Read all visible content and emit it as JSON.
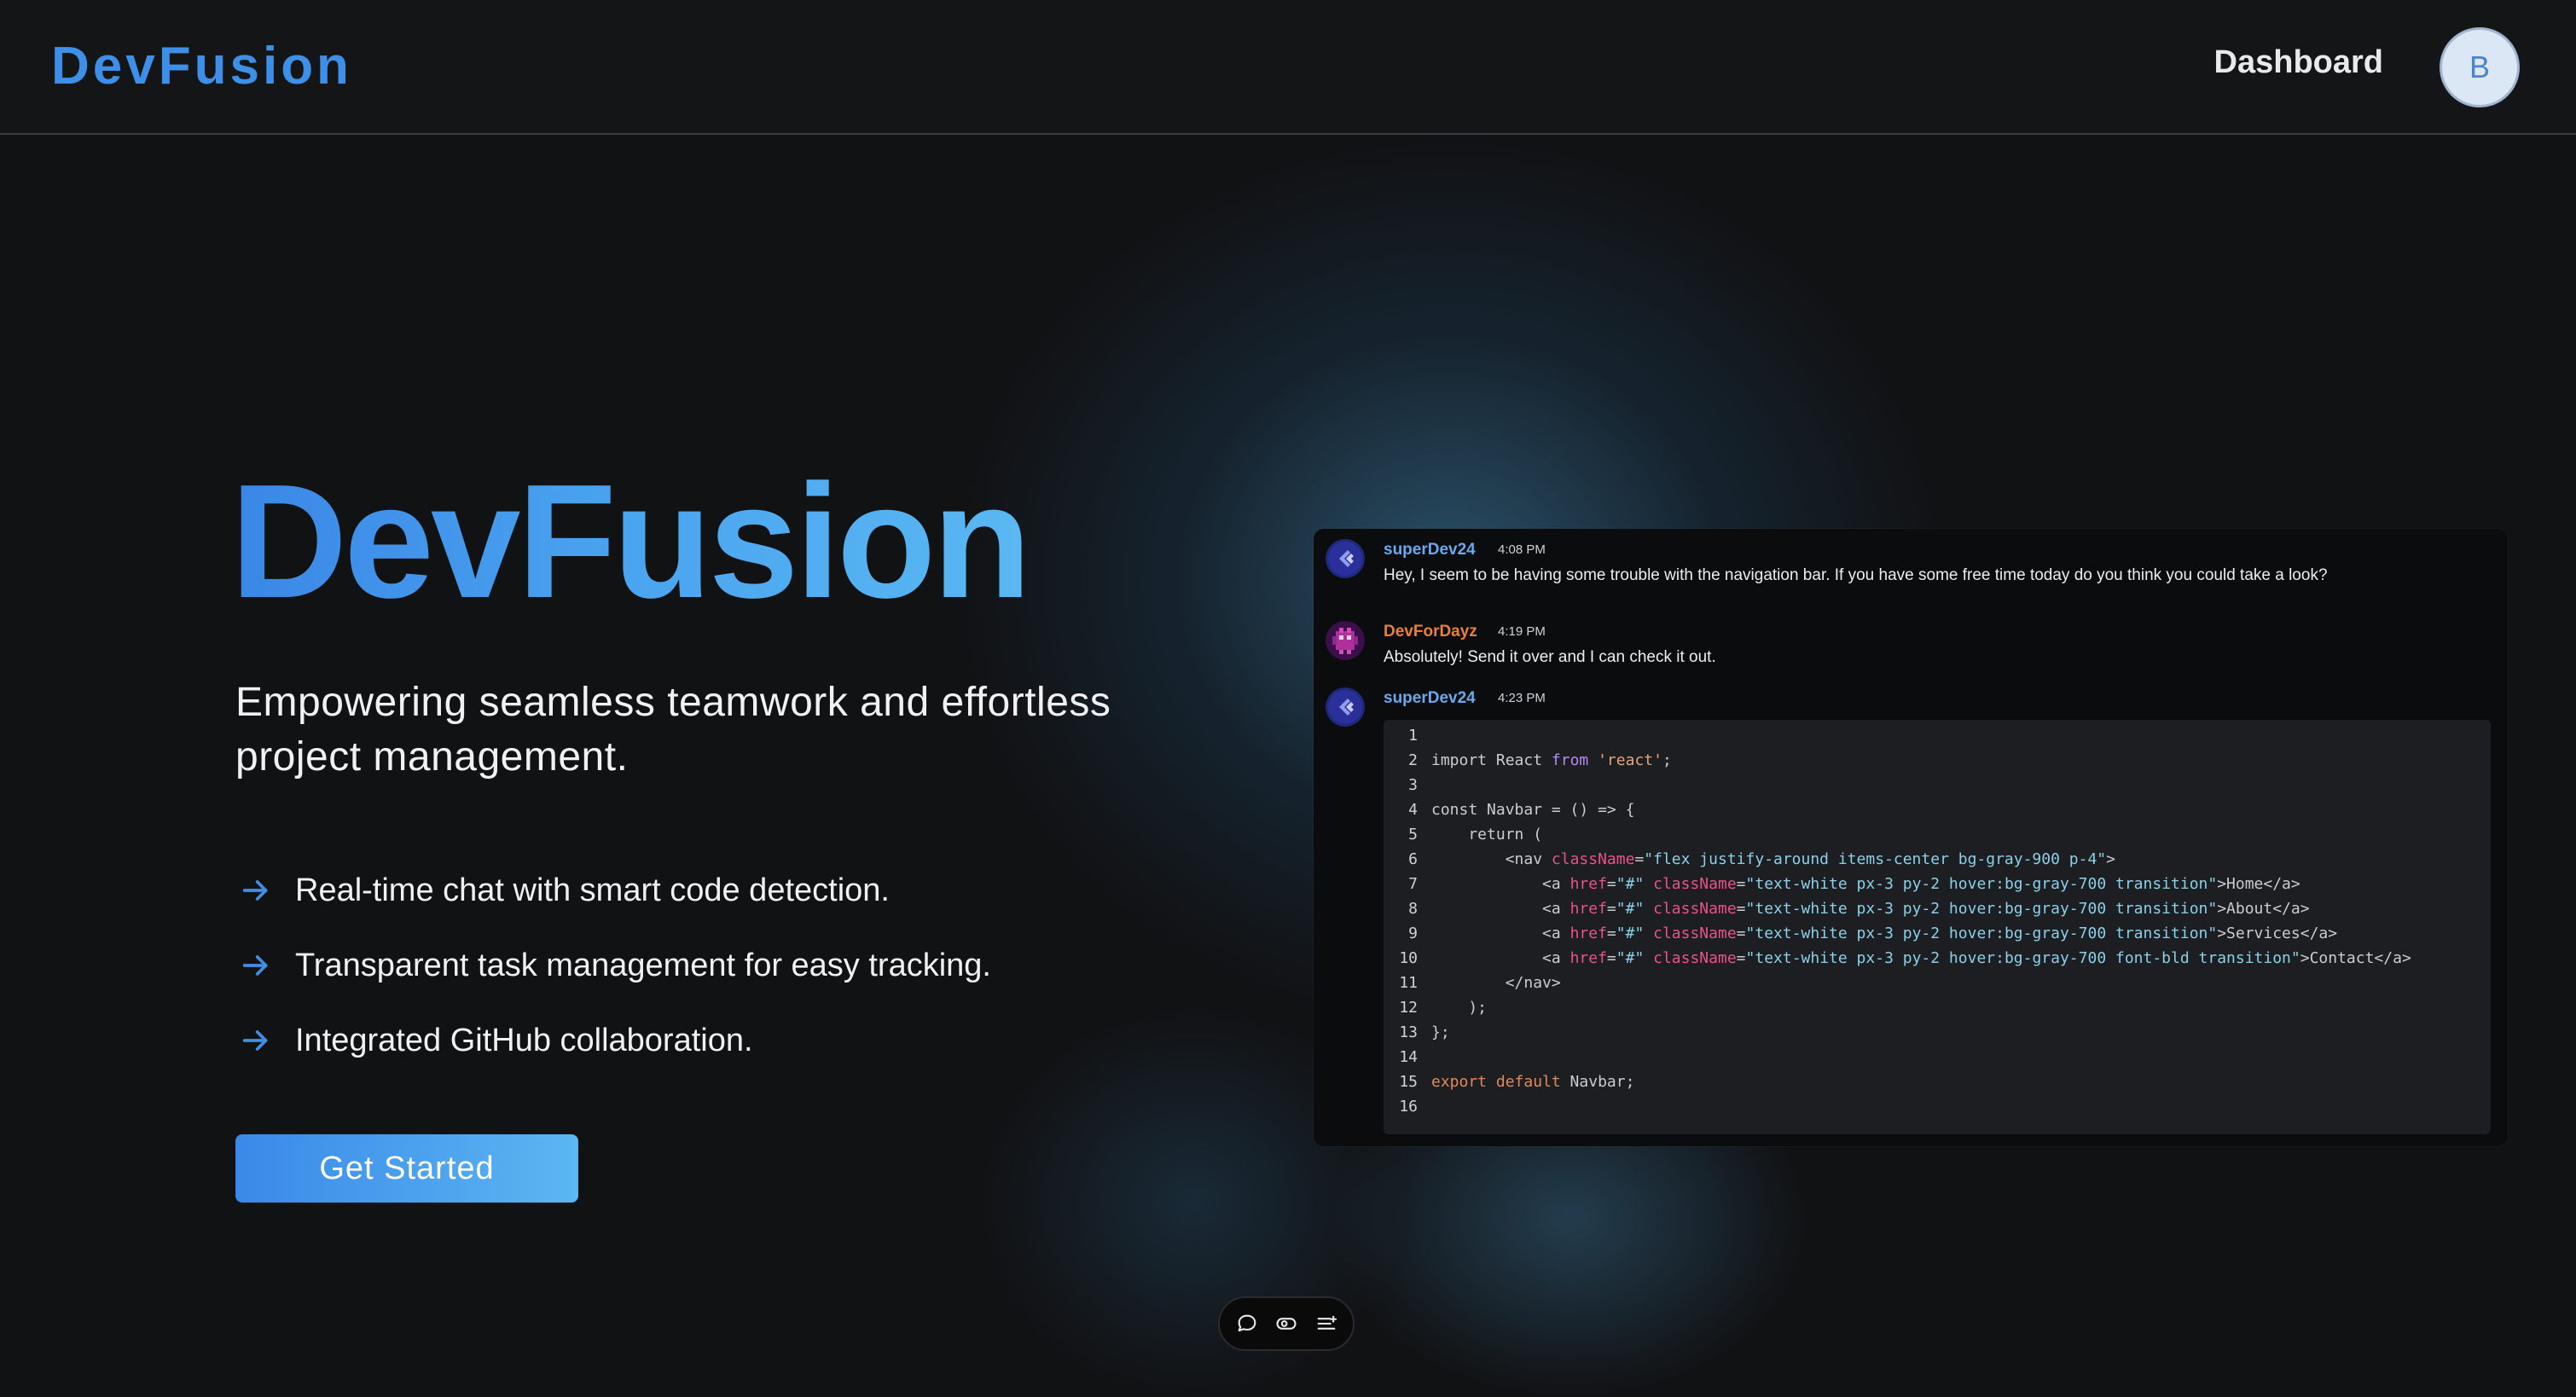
{
  "header": {
    "brand": "DevFusion",
    "nav_dashboard": "Dashboard",
    "avatar_initial": "B"
  },
  "hero": {
    "title": "DevFusion",
    "subtitle": "Empowering seamless teamwork and effortless project management.",
    "features": [
      "Real-time chat with smart code detection.",
      "Transparent task management for easy tracking.",
      "Integrated GitHub collaboration."
    ],
    "cta_label": "Get Started"
  },
  "chat": {
    "messages": [
      {
        "author": "superDev24",
        "time": "4:08 PM",
        "text": "Hey, I seem to be having some trouble with the navigation bar. If you have some free time today do you think you could take a look?"
      },
      {
        "author": "DevForDayz",
        "time": "4:19 PM",
        "text": "Absolutely! Send it over and I can check it out."
      },
      {
        "author": "superDev24",
        "time": "4:23 PM",
        "text": ""
      }
    ],
    "code_lines": [
      "",
      "import React from 'react';",
      "",
      "const Navbar = () => {",
      "    return (",
      "        <nav className=\"flex justify-around items-center bg-gray-900 p-4\">",
      "            <a href=\"#\" className=\"text-white px-3 py-2 hover:bg-gray-700 transition\">Home</a>",
      "            <a href=\"#\" className=\"text-white px-3 py-2 hover:bg-gray-700 transition\">About</a>",
      "            <a href=\"#\" className=\"text-white px-3 py-2 hover:bg-gray-700 transition\">Services</a>",
      "            <a href=\"#\" className=\"text-white px-3 py-2 hover:bg-gray-700 font-bld transition\">Contact</a>",
      "        </nav>",
      "    );",
      "};",
      "",
      "export default Navbar;",
      ""
    ]
  },
  "colors": {
    "accent": "#3d8fe8",
    "superDev24_name": "#6aa9ee",
    "DevForDayz_name": "#e9803a",
    "background": "#111214"
  },
  "icons": {
    "feature_bullet": "arrow-right-icon",
    "toolbar": [
      "chat-bubble-icon",
      "toggle-icon",
      "list-icon"
    ]
  }
}
